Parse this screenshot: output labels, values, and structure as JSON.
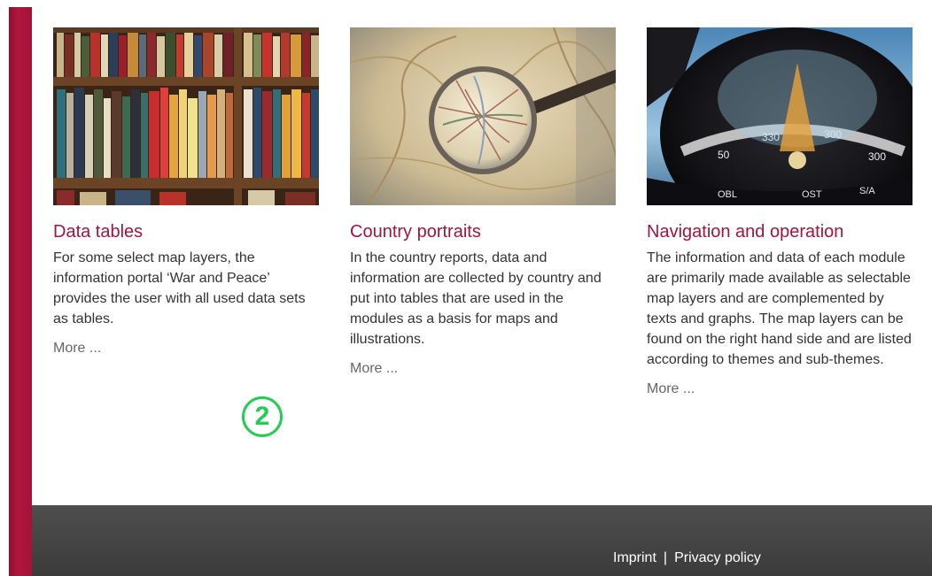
{
  "cards": [
    {
      "title": "Data tables",
      "text": "For some select map layers, the information portal ‘War and Peace’ provides the user with all used data sets as tables.",
      "more": "More ..."
    },
    {
      "title": "Country portraits",
      "text": "In the country reports, data and information are collected by country and put into tables that are used in the modules as a basis for maps and illustrations.",
      "more": "More ..."
    },
    {
      "title": "Navigation and operation",
      "text": "The information and data of each module are primarily made available as selectable map layers and are complemented by texts and graphs. The map layers can be found on the right hand side and are listed according to themes and sub-themes.",
      "more": "More ..."
    }
  ],
  "badge": "2",
  "footer": {
    "imprint": "Imprint",
    "separator": "|",
    "privacy": "Privacy policy"
  },
  "colors": {
    "accent": "#a0153e",
    "footer_bg": "#444444",
    "badge": "#22cc55"
  }
}
